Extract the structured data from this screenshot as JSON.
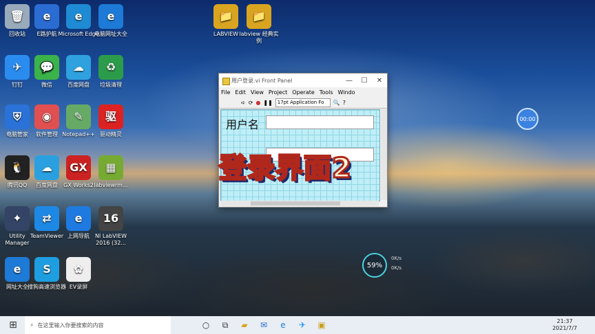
{
  "desktop": {
    "icons": [
      {
        "label": "回收站",
        "glyph": "🗑"
      },
      {
        "label": "E路护航",
        "glyph": "e"
      },
      {
        "label": "Microsoft Edge",
        "glyph": "e"
      },
      {
        "label": "电脑网址大全",
        "glyph": "e"
      },
      {
        "label": "钉钉",
        "glyph": "✈"
      },
      {
        "label": "微信",
        "glyph": "💬"
      },
      {
        "label": "百度网盘",
        "glyph": "☁"
      },
      {
        "label": "垃圾清理",
        "glyph": "♻"
      },
      {
        "label": "电脑管家",
        "glyph": "⛨"
      },
      {
        "label": "软件管理",
        "glyph": "◉"
      },
      {
        "label": "Notepad++",
        "glyph": "✎"
      },
      {
        "label": "驱动精灵",
        "glyph": "驱"
      },
      {
        "label": "腾讯QQ",
        "glyph": "🐧"
      },
      {
        "label": "百度网盘",
        "glyph": "☁"
      },
      {
        "label": "GX Works2",
        "glyph": "GX"
      },
      {
        "label": "labviewrm...",
        "glyph": "▦"
      },
      {
        "label": "Utility Manager",
        "glyph": "✦"
      },
      {
        "label": "TeamViewer",
        "glyph": "⇄"
      },
      {
        "label": "上网导航",
        "glyph": "e"
      },
      {
        "label": "NI LabVIEW 2016 (32...",
        "glyph": "16"
      },
      {
        "label": "网址大全",
        "glyph": "e"
      },
      {
        "label": "搜狗高速浏览器",
        "glyph": "S"
      },
      {
        "label": "EV录屏",
        "glyph": "✿"
      },
      {
        "label": "LABVIEW",
        "glyph": "📁"
      },
      {
        "label": "labview 经典实例",
        "glyph": "📁"
      }
    ]
  },
  "window": {
    "title": "用户登录.vi Front Panel",
    "controls": [
      "—",
      "☐",
      "✕"
    ],
    "menu": [
      "File",
      "Edit",
      "View",
      "Project",
      "Operate",
      "Tools",
      "Windo"
    ],
    "font": "17pt Application Fo",
    "username_label": "用户名"
  },
  "overlay_text": "登录界面2",
  "widget": {
    "timer": "00:00",
    "percent": "59%",
    "up": "0K/s",
    "down": "0K/s"
  },
  "taskbar": {
    "search_placeholder": "在这里输入你要搜索的内容",
    "time": "21:37",
    "date": "2021/7/7"
  }
}
